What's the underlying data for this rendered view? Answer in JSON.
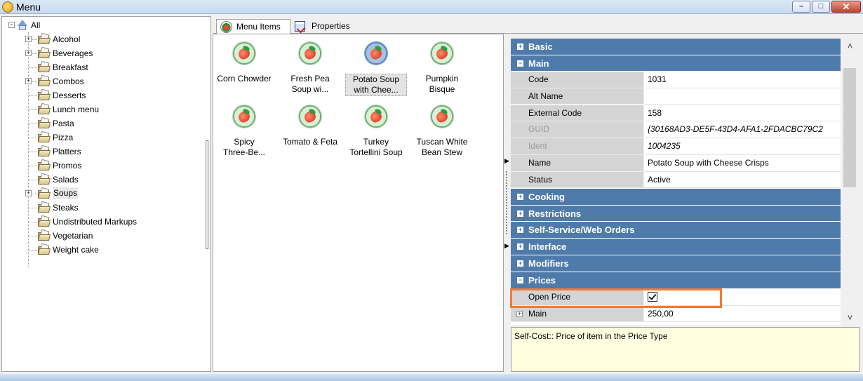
{
  "window": {
    "title": "Menu",
    "buttons": {
      "minimize": "–",
      "maximize": "□",
      "close": "✕"
    }
  },
  "tree": {
    "root": "All",
    "items": [
      {
        "label": "Alcohol",
        "expandable": true
      },
      {
        "label": "Beverages",
        "expandable": true
      },
      {
        "label": "Breakfast",
        "expandable": false
      },
      {
        "label": "Combos",
        "expandable": true
      },
      {
        "label": "Desserts",
        "expandable": false
      },
      {
        "label": "Lunch menu",
        "expandable": false
      },
      {
        "label": "Pasta",
        "expandable": false
      },
      {
        "label": "Pizza",
        "expandable": false
      },
      {
        "label": "Platters",
        "expandable": false
      },
      {
        "label": "Promos",
        "expandable": false
      },
      {
        "label": "Salads",
        "expandable": false
      },
      {
        "label": "Soups",
        "expandable": true,
        "selected": true
      },
      {
        "label": "Steaks",
        "expandable": false
      },
      {
        "label": "Undistributed Markups",
        "expandable": false
      },
      {
        "label": "Vegetarian",
        "expandable": false
      },
      {
        "label": "Weight cake",
        "expandable": false
      }
    ]
  },
  "tabs": [
    {
      "label": "Menu Items",
      "active": true
    },
    {
      "label": "Properties",
      "active": false
    }
  ],
  "menu_items": [
    {
      "line1": "Corn Chowder",
      "line2": ""
    },
    {
      "line1": "Fresh Pea",
      "line2": "Soup wi..."
    },
    {
      "line1": "Potato Soup",
      "line2": "with Chee...",
      "selected": true
    },
    {
      "line1": "Pumpkin",
      "line2": "Bisque"
    },
    {
      "line1": "Spicy",
      "line2": "Three-Be..."
    },
    {
      "line1": "Tomato & Feta",
      "line2": ""
    },
    {
      "line1": "Turkey",
      "line2": "Tortellini Soup"
    },
    {
      "line1": "Tuscan White",
      "line2": "Bean Stew"
    }
  ],
  "properties": {
    "categories": {
      "basic": "Basic",
      "main": "Main",
      "cooking": "Cooking",
      "restrictions": "Restrictions",
      "self_service": "Self-Service/Web Orders",
      "interface": "Interface",
      "modifiers": "Modifiers",
      "prices": "Prices"
    },
    "main": [
      {
        "name": "Code",
        "value": "1031"
      },
      {
        "name": "Alt Name",
        "value": ""
      },
      {
        "name": "External Code",
        "value": "158"
      },
      {
        "name": "GUID",
        "value": "{30168AD3-DE5F-43D4-AFA1-2FDACBC79C2",
        "disabled": true
      },
      {
        "name": "Ident",
        "value": "1004235",
        "disabled": true
      },
      {
        "name": "Name",
        "value": "Potato Soup with Cheese Crisps"
      },
      {
        "name": "Status",
        "value": "Active"
      }
    ],
    "prices": {
      "open_price": {
        "name": "Open Price",
        "checked": true
      },
      "main": {
        "name": "Main",
        "value": "250,00"
      }
    }
  },
  "description": "Self-Cost:: Price of item in the Price Type",
  "colors": {
    "category_bg": "#4f7bab",
    "highlight": "#f37a35",
    "description_bg": "#ffffe1"
  }
}
